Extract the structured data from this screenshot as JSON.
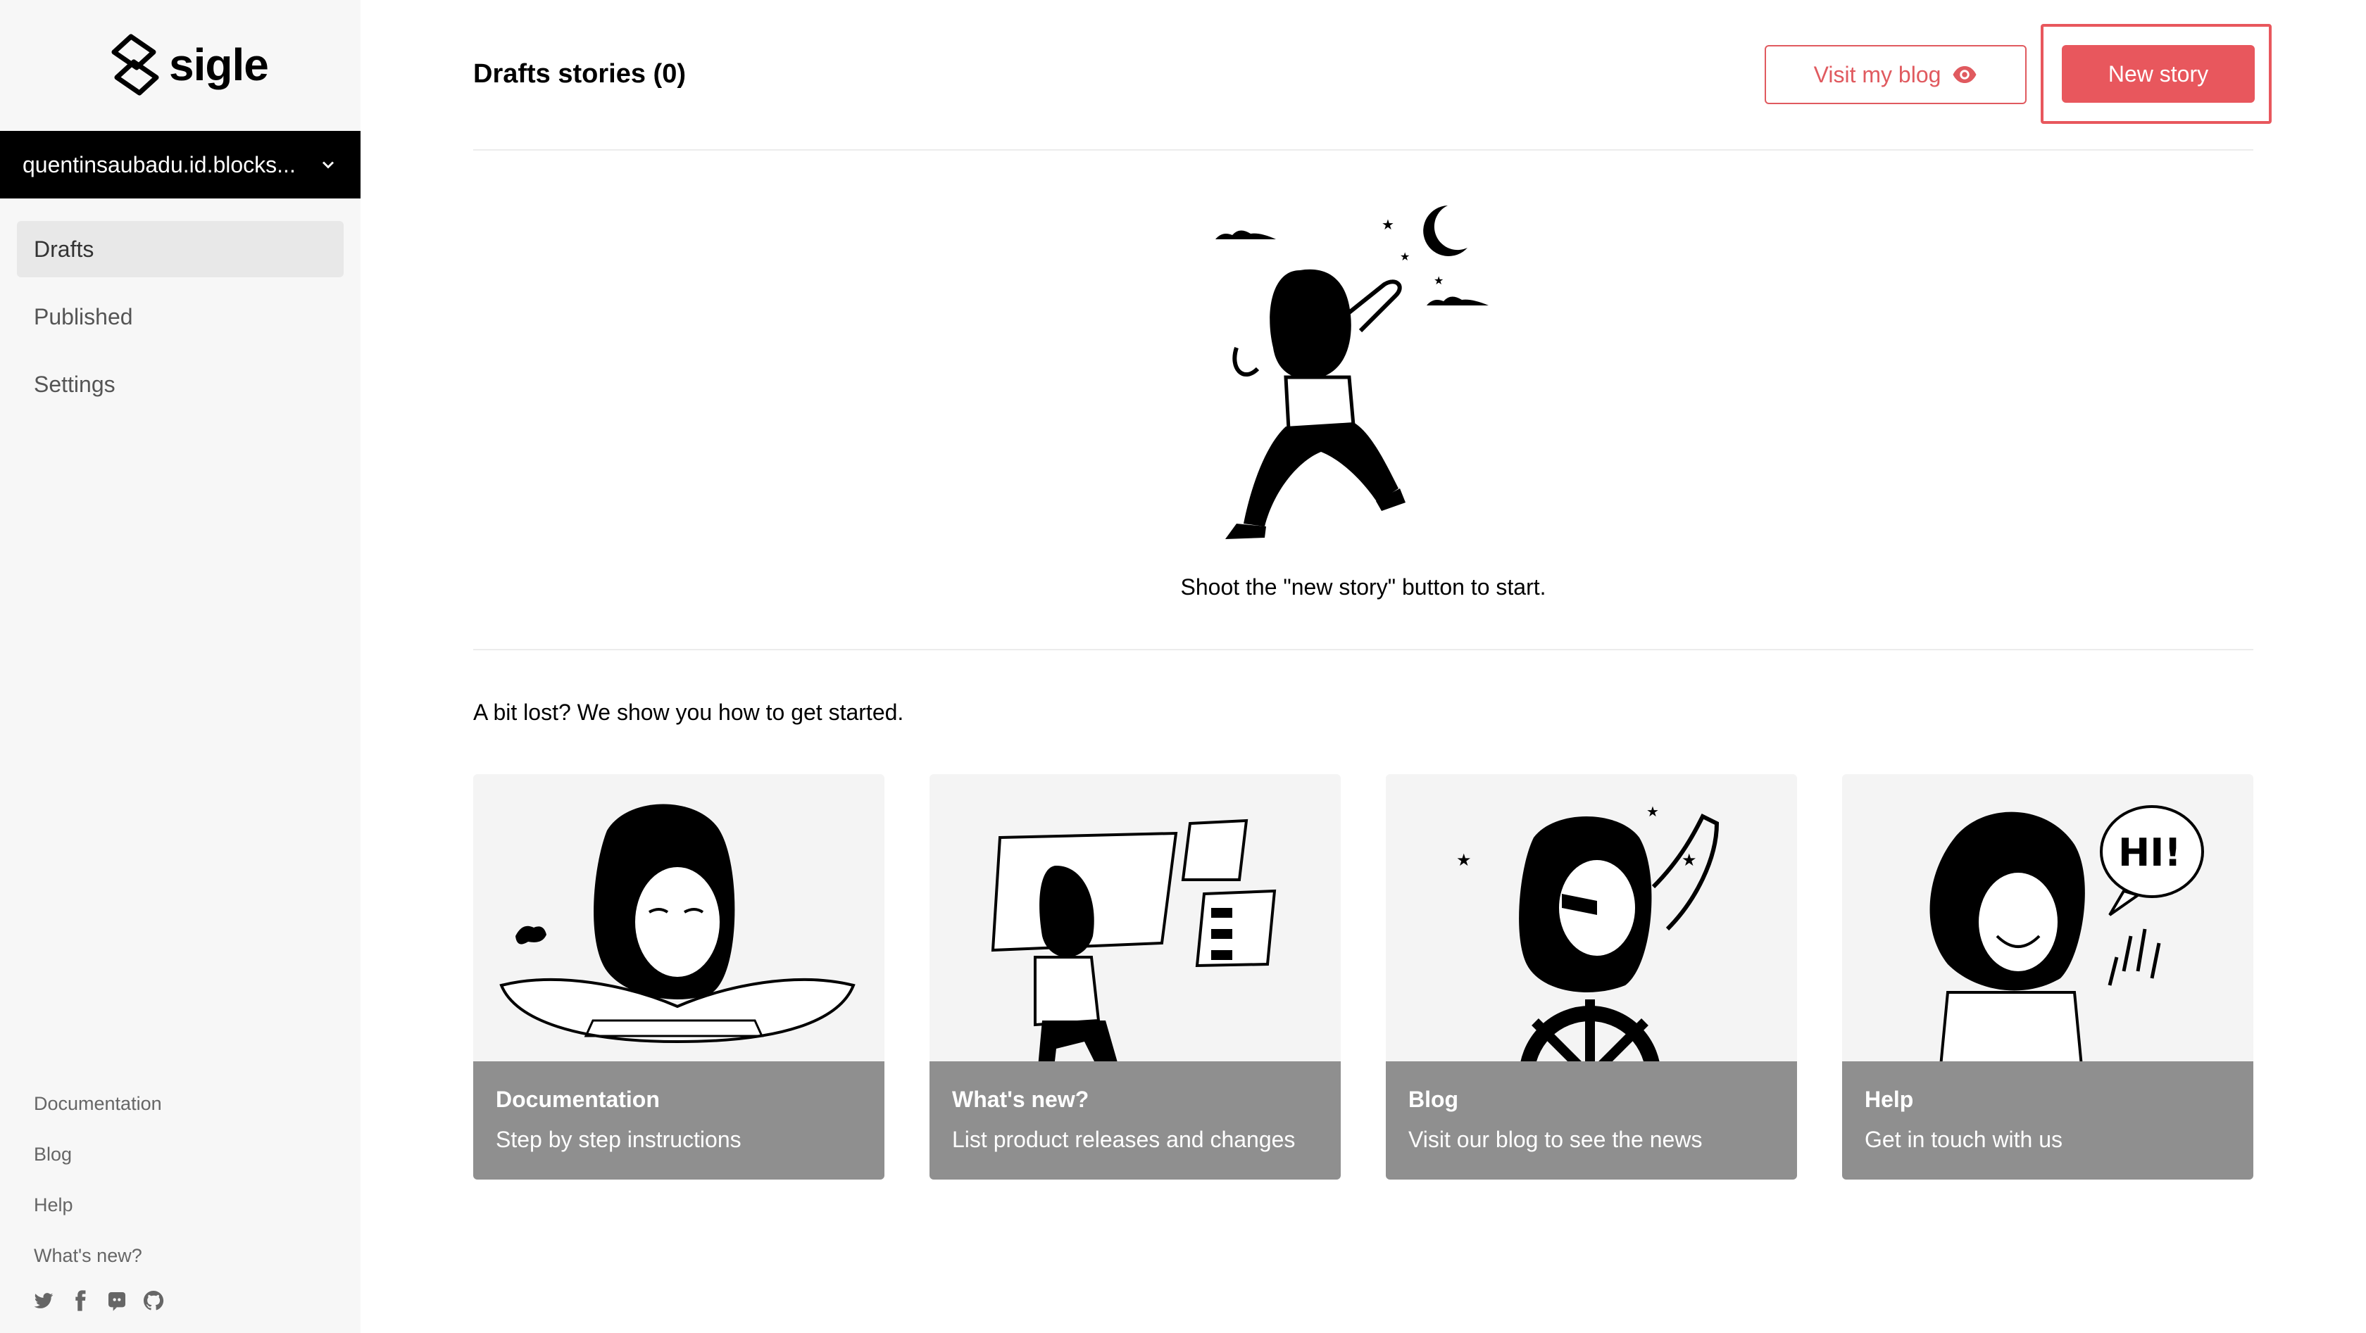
{
  "brand": {
    "name": "sigle"
  },
  "account": {
    "name": "quentinsaubadu.id.blocks..."
  },
  "sidebar": {
    "nav": [
      {
        "label": "Drafts",
        "active": true
      },
      {
        "label": "Published",
        "active": false
      },
      {
        "label": "Settings",
        "active": false
      }
    ],
    "footer_links": [
      "Documentation",
      "Blog",
      "Help",
      "What's new?"
    ],
    "socials": [
      "twitter-icon",
      "facebook-icon",
      "discord-icon",
      "github-icon"
    ]
  },
  "header": {
    "title": "Drafts stories (0)",
    "visit_label": "Visit my blog",
    "new_story_label": "New story"
  },
  "empty_state": {
    "message": "Shoot the \"new story\" button to start."
  },
  "getting_started": {
    "heading": "A bit lost? We show you how to get started.",
    "cards": [
      {
        "title": "Documentation",
        "description": "Step by step instructions"
      },
      {
        "title": "What's new?",
        "description": "List product releases and changes"
      },
      {
        "title": "Blog",
        "description": "Visit our blog to see the news"
      },
      {
        "title": "Help",
        "description": "Get in touch with us"
      }
    ]
  },
  "colors": {
    "accent": "#e8575d",
    "sidebar_bg": "#f7f7f7",
    "caption_bg": "#8f8f8f"
  }
}
